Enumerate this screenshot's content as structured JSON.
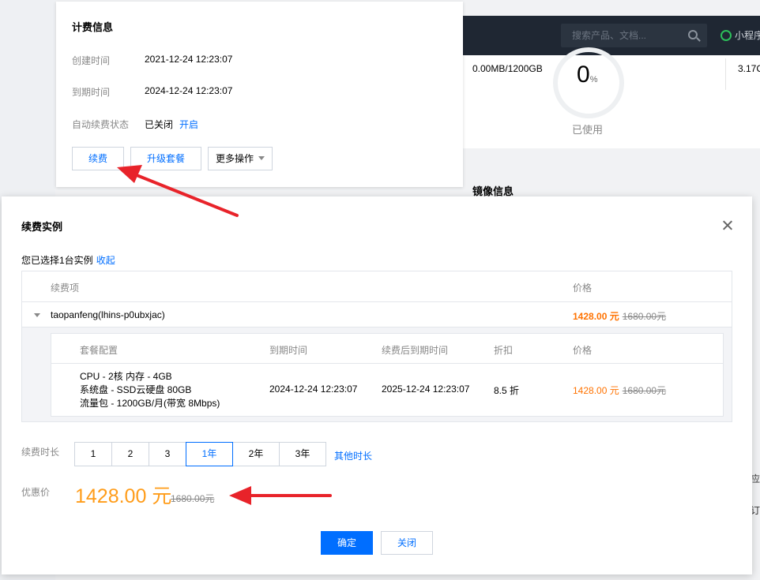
{
  "background": {
    "search_placeholder": "搜索产品、文档...",
    "mini_program": "小程序",
    "traffic_text": "0.00MB/1200GB",
    "usage_value": "0",
    "usage_unit": "%",
    "usage_label": "已使用",
    "right_value": "3.17C",
    "mirror_title": "镜像信息",
    "fragment_1": "应",
    "fragment_2": "订"
  },
  "billing_card": {
    "title": "计费信息",
    "created_label": "创建时间",
    "created_value": "2021-12-24 12:23:07",
    "expire_label": "到期时间",
    "expire_value": "2024-12-24 12:23:07",
    "auto_renew_label": "自动续费状态",
    "auto_renew_value": "已关闭",
    "auto_renew_link": "开启",
    "renew_button": "续费",
    "upgrade_button": "升级套餐",
    "more_button": "更多操作"
  },
  "dialog": {
    "title": "续费实例",
    "selected_text": "您已选择1台实例",
    "collapse_link": "收起",
    "table": {
      "col_item": "续费项",
      "col_price": "价格",
      "instance_name": "taopanfeng(lhins-p0ubxjac)",
      "instance_price": "1428.00 元",
      "instance_old_price": "1680.00元",
      "inner": {
        "col_config": "套餐配置",
        "col_expire": "到期时间",
        "col_new_expire": "续费后到期时间",
        "col_discount": "折扣",
        "col_price": "价格",
        "config_lines": [
          "CPU - 2核 内存 - 4GB",
          "系统盘 - SSD云硬盘 80GB",
          "流量包 - 1200GB/月(带宽 8Mbps)"
        ],
        "expire": "2024-12-24 12:23:07",
        "new_expire": "2025-12-24 12:23:07",
        "discount": "8.5 折",
        "price": "1428.00 元",
        "old_price": "1680.00元"
      }
    },
    "duration_label": "续费时长",
    "durations": [
      "1",
      "2",
      "3",
      "1年",
      "2年",
      "3年"
    ],
    "selected_duration": "1年",
    "other_duration": "其他时长",
    "discount_label": "优惠价",
    "final_price": "1428.00 元",
    "final_old_price": "1680.00元",
    "confirm_button": "确定",
    "cancel_button": "关闭"
  },
  "colors": {
    "primary": "#006eff",
    "price_orange": "#ff7200",
    "arrow_red": "#e8232a"
  }
}
